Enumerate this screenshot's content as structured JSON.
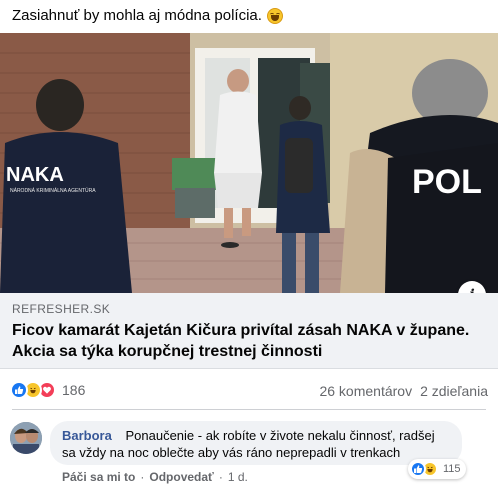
{
  "post": {
    "text": "Zasiahnuť by mohla aj módna polícia."
  },
  "link": {
    "domain": "REFRESHER.SK",
    "title": "Ficov kamarát Kajetán Kičura privítal zásah NAKA v župane. Akcia sa týka korupčnej trestnej činnosti",
    "image_jacket_left": "NAKA",
    "image_jacket_left_sub": "NÁRODNÁ KRIMINÁLNA AGENTÚRA",
    "image_jacket_right": "POL"
  },
  "reactions": {
    "icons": [
      "like-icon",
      "haha-icon",
      "love-icon"
    ],
    "count": "186"
  },
  "stats": {
    "comments": "26 komentárov",
    "shares": "2 zdieľania"
  },
  "comment": {
    "author": "Barbora",
    "text": "Ponaučenie - ak robíte v živote nekalu činnosť, radšej sa vždy na noc oblečte aby vás ráno neprepadli v trenkach",
    "reaction_count": "115",
    "actions": {
      "like": "Páči sa mi to",
      "reply": "Odpovedať",
      "time": "1 d."
    }
  },
  "colors": {
    "like_blue": "#1877f2",
    "haha_yellow": "#f7c52b",
    "love_red": "#f33e58",
    "link_bg": "#f0f2f5",
    "author": "#385898"
  }
}
